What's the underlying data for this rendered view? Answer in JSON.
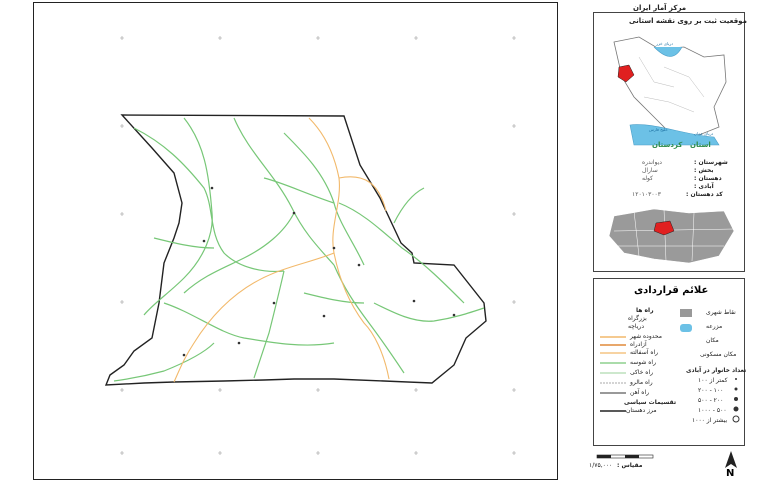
{
  "header": {
    "title": "مرکز آمار ایران"
  },
  "location_box": {
    "title": "موقعیت ثبت بر روی نقشه استانی",
    "province_label": "استان",
    "province_name": "کردستان",
    "caspian": "دریای خزر",
    "gulf": "خلیج فارس",
    "oman": "دریای عمان",
    "info_keys": [
      "شهرستان :",
      "بخش :",
      "دهستان :",
      "آبادی :",
      "کد دهستان :"
    ],
    "info_values": [
      "دیواندره",
      "سارال",
      "کوله",
      "",
      "۱۲۰۱۰۳۰۰۳"
    ]
  },
  "legend": {
    "title": "علائم قراردادی",
    "left_items": [
      "نقاط شهری",
      "مزرعه",
      "مکان",
      "مکان مسکونی"
    ],
    "roads_title": "راه ها",
    "roads": [
      "محدوده شهر",
      "آزادراه",
      "راه آسفالته",
      "راه شوسه",
      "راه خاکی",
      "راه مالرو",
      "راه آهن"
    ],
    "right_items": [
      "بزرگراه",
      "دریاچه"
    ],
    "political_title": "تقسیمات سیاسی",
    "political": [
      "مرز دهستان"
    ],
    "pop_title": "تعداد خانوار در آبادی",
    "pop_classes": [
      "کمتر از ۱۰۰",
      "۱۰۰ - ۲۰۰",
      "۲۰۰ - ۵۰۰",
      "۵۰۰ - ۱۰۰۰",
      "بیشتر از ۱۰۰۰"
    ]
  },
  "scale": {
    "label": "مقیاس :",
    "value": "۱/۷۵,۰۰۰"
  },
  "north": {
    "letter": "N"
  },
  "colors": {
    "road_green": "#77c777",
    "road_orange": "#f2b96b",
    "boundary": "#222222",
    "province_red": "#e02020",
    "province_grey": "#9a9a9a",
    "water_blue": "#6cc1e6",
    "border_green": "#2e8b4a"
  }
}
